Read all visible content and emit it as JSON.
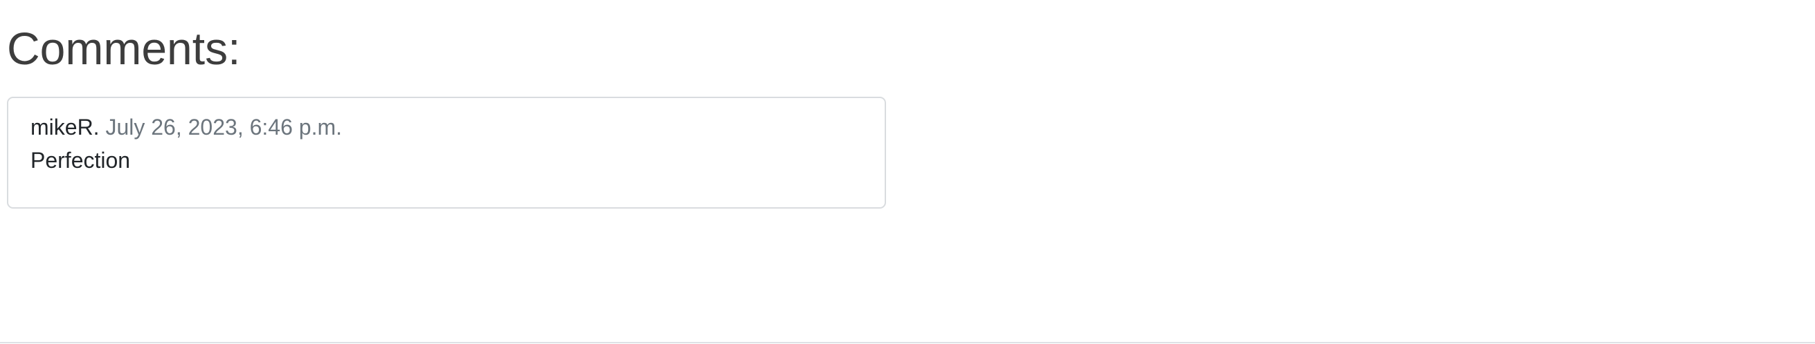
{
  "comments_section": {
    "heading": "Comments:",
    "comments": [
      {
        "author": "mikeR.",
        "date": "July 26, 2023, 6:46 p.m.",
        "body": "Perfection"
      }
    ]
  },
  "colors": {
    "heading": "#3d3d3d",
    "author": "#212529",
    "date": "#6c757d",
    "card_border": "#d9dcdf"
  }
}
